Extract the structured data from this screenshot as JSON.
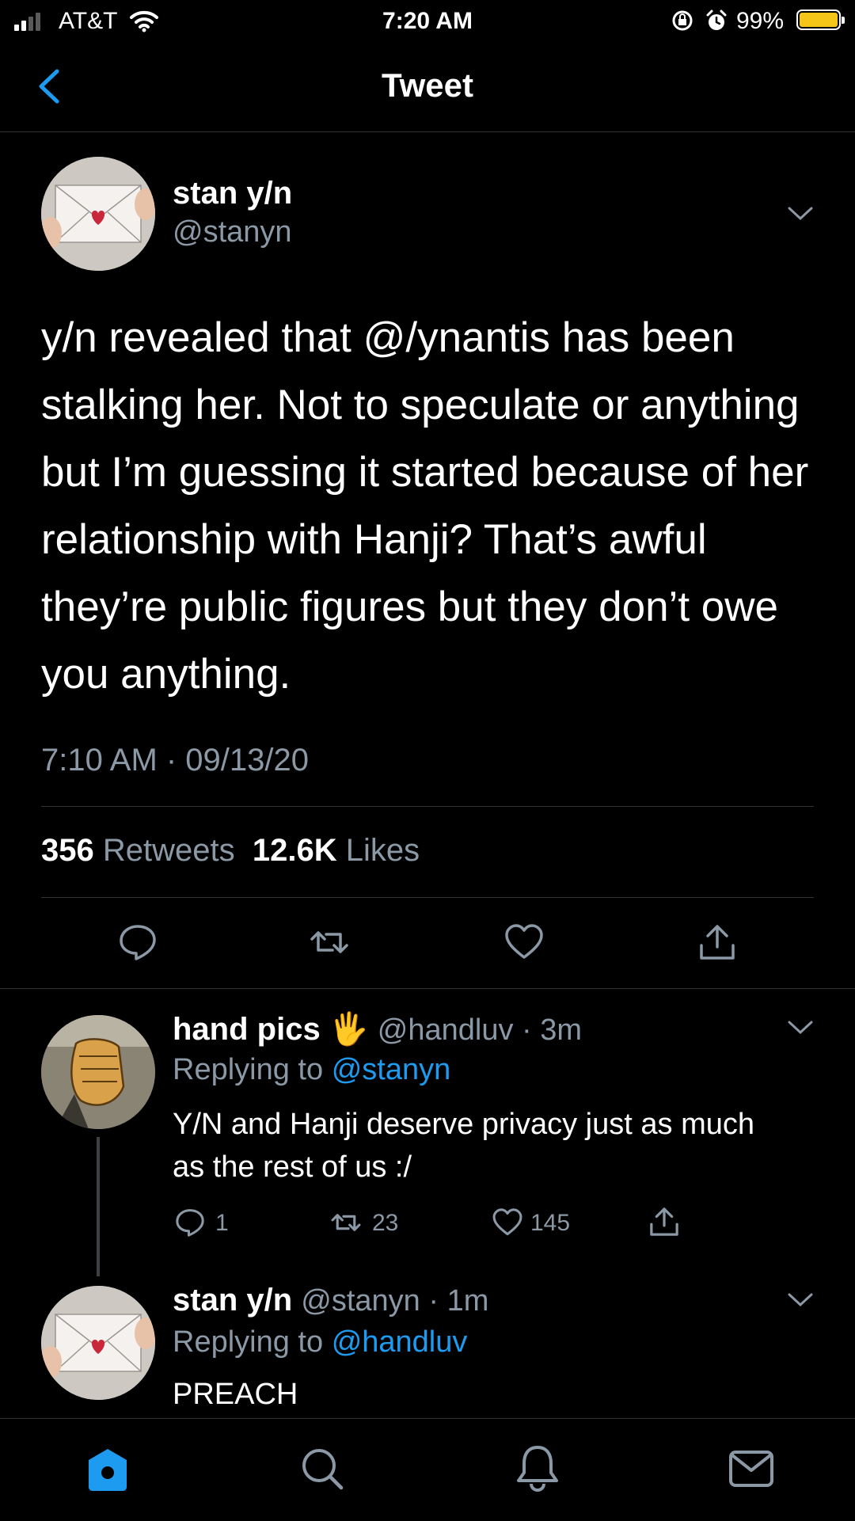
{
  "status_bar": {
    "carrier": "AT&T",
    "time": "7:20 AM",
    "battery": "99%"
  },
  "nav": {
    "title": "Tweet"
  },
  "tweet": {
    "author_name": "stan y/n",
    "author_handle": "@stanyn",
    "text": "y/n revealed that @/ynantis has been stalking her. Not to speculate or anything but I’m guessing it started because of her relationship with Hanji? That’s awful they’re public figures but they don’t owe you anything.",
    "timestamp": "7:10 AM · 09/13/20",
    "retweets_count": "356",
    "retweets_label": "Retweets",
    "likes_count": "12.6K",
    "likes_label": "Likes"
  },
  "replies": [
    {
      "name": "hand pics",
      "emoji": "🖐",
      "handle_time": "@handluv · 3m",
      "replying_prefix": "Replying to",
      "replying_to": "@stanyn",
      "text": "Y/N and Hanji deserve privacy just as much as the rest of us :/",
      "reply_count": "1",
      "retweet_count": "23",
      "like_count": "145"
    },
    {
      "name": "stan y/n",
      "handle_time": "@stanyn · 1m",
      "replying_prefix": "Replying to",
      "replying_to": "@handluv",
      "text": "PREACH"
    }
  ],
  "colors": {
    "background": "#000000",
    "accent": "#1d9bf0",
    "muted": "#8b98a5",
    "battery": "#f5c518"
  },
  "icons": [
    "signal-icon",
    "wifi-icon",
    "orientation-lock-icon",
    "alarm-icon",
    "battery-icon",
    "back-chevron-icon",
    "chevron-down-icon",
    "reply-icon",
    "retweet-icon",
    "like-icon",
    "share-icon",
    "home-icon",
    "search-icon",
    "notifications-icon",
    "messages-icon"
  ]
}
